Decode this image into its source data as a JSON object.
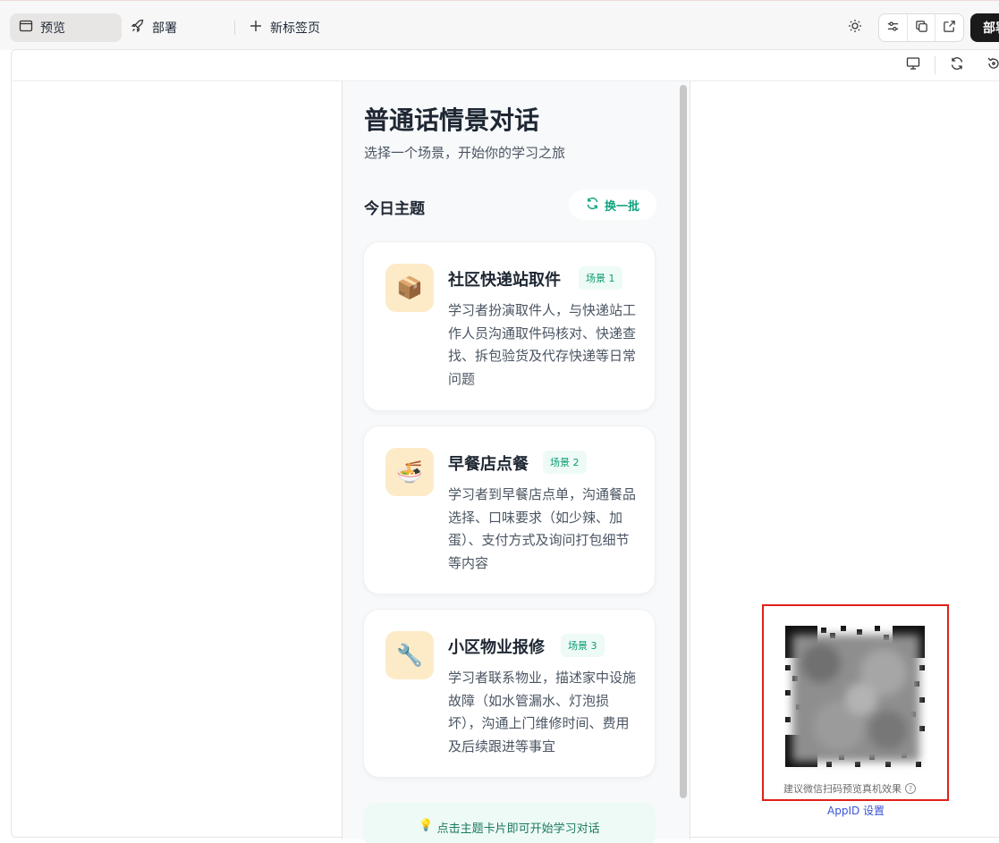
{
  "topbar": {
    "tabs": [
      {
        "label": "预览",
        "icon": "window-icon",
        "active": true
      },
      {
        "label": "部署",
        "icon": "rocket-icon",
        "active": false
      }
    ],
    "new_tab_label": "新标签页",
    "deploy_label": "部署"
  },
  "preview_toolbar": {
    "icons": [
      "monitor-icon",
      "refresh-icon",
      "rotate-icon"
    ]
  },
  "app": {
    "title": "普通话情景对话",
    "subtitle": "选择一个场景，开始你的学习之旅",
    "section_title": "今日主题",
    "refresh_label": "换一批",
    "cards": [
      {
        "emoji": "📦",
        "title": "社区快递站取件",
        "badge": "场景 1",
        "desc": "学习者扮演取件人，与快递站工作人员沟通取件码核对、快递查找、拆包验货及代存快递等日常问题"
      },
      {
        "emoji": "🍜",
        "title": "早餐店点餐",
        "badge": "场景 2",
        "desc": "学习者到早餐店点单，沟通餐品选择、口味要求（如少辣、加蛋）、支付方式及询问打包细节等内容"
      },
      {
        "emoji": "🔧",
        "title": "小区物业报修",
        "badge": "场景 3",
        "desc": "学习者联系物业，描述家中设施故障（如水管漏水、灯泡损坏），沟通上门维修时间、费用及后续跟进等事宜"
      }
    ],
    "tip": "点击主题卡片即可开始学习对话",
    "tip_icon": "💡"
  },
  "qr": {
    "caption": "建议微信扫码预览真机效果",
    "help": "?",
    "appid_link": "AppID 设置"
  },
  "colors": {
    "accent": "#10a37f",
    "badge_bg": "#eefaf5",
    "emoji_bg": "#fdebc8",
    "highlight_border": "#e0201a",
    "link": "#3a53d6"
  }
}
